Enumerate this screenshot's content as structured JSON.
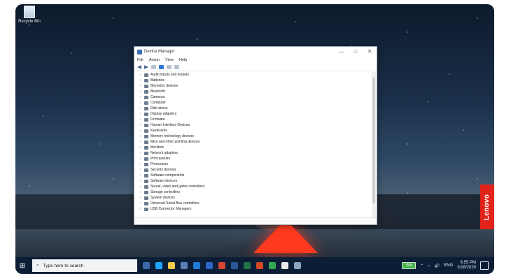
{
  "desktop": {
    "recycle_bin_label": "Recycle Bin",
    "lenovo_label": "Lenovo"
  },
  "window": {
    "title": "Device Manager",
    "controls": {
      "minimize": "—",
      "maximize": "□",
      "close": "✕"
    },
    "menu": [
      "File",
      "Action",
      "View",
      "Help"
    ],
    "devices": [
      "Audio inputs and outputs",
      "Batteries",
      "Biometric devices",
      "Bluetooth",
      "Cameras",
      "Computer",
      "Disk drives",
      "Display adapters",
      "Firmware",
      "Human Interface Devices",
      "Keyboards",
      "Memory technology devices",
      "Mice and other pointing devices",
      "Monitors",
      "Network adapters",
      "Print queues",
      "Processors",
      "Security devices",
      "Software components",
      "Software devices",
      "Sound, video and game controllers",
      "Storage controllers",
      "System devices",
      "Universal Serial Bus controllers",
      "USB Connector Managers"
    ]
  },
  "taskbar": {
    "search_placeholder": "Type here to search",
    "battery": "75%",
    "language": "ENG",
    "time": "6:55 PM",
    "date": "3/16/2020"
  },
  "colors": {
    "taskbar": "#0b1e35",
    "lenovo": "#e2231a",
    "tent": "#ff3a1f"
  }
}
